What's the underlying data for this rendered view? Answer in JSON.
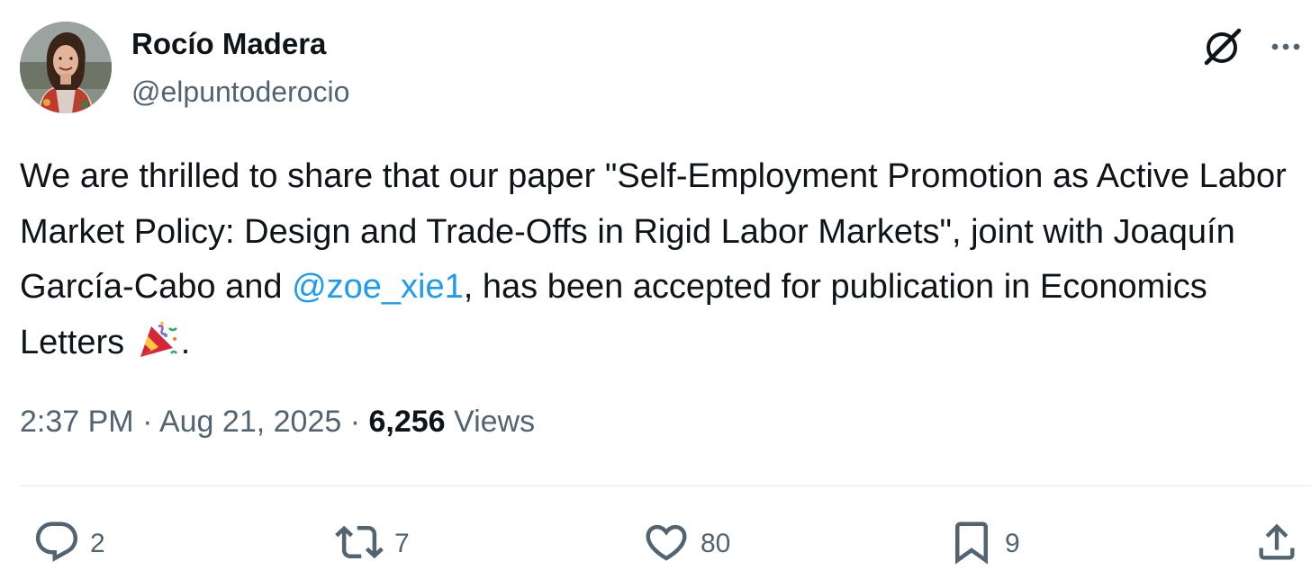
{
  "author": {
    "name": "Rocío Madera",
    "handle": "@elpuntoderocio",
    "avatar": "profile-photo"
  },
  "tweet": {
    "text_before_mention": "We are thrilled to share that our paper \"Self-Employment Promotion as Active Labor Market Policy: Design and Trade-Offs in Rigid Labor Markets\", joint with Joaquín García-Cabo and ",
    "mention": "@zoe_xie1",
    "text_after_mention": ", has been accepted for publication in Economics Letters ",
    "emoji": "party-popper",
    "text_end": "."
  },
  "meta": {
    "time": "2:37 PM",
    "separator": " · ",
    "date": "Aug 21, 2025",
    "views_count": "6,256",
    "views_label": " Views"
  },
  "actions": {
    "replies": "2",
    "reposts": "7",
    "likes": "80",
    "bookmarks": "9"
  },
  "icons": {
    "grok": "grok-icon",
    "more": "more-icon",
    "reply": "reply-icon",
    "repost": "repost-icon",
    "like": "like-icon",
    "bookmark": "bookmark-icon",
    "share": "share-icon"
  },
  "colors": {
    "link": "#1d9bf0",
    "text": "#0f1419",
    "secondary": "#536471",
    "divider": "#e1e8ed"
  }
}
